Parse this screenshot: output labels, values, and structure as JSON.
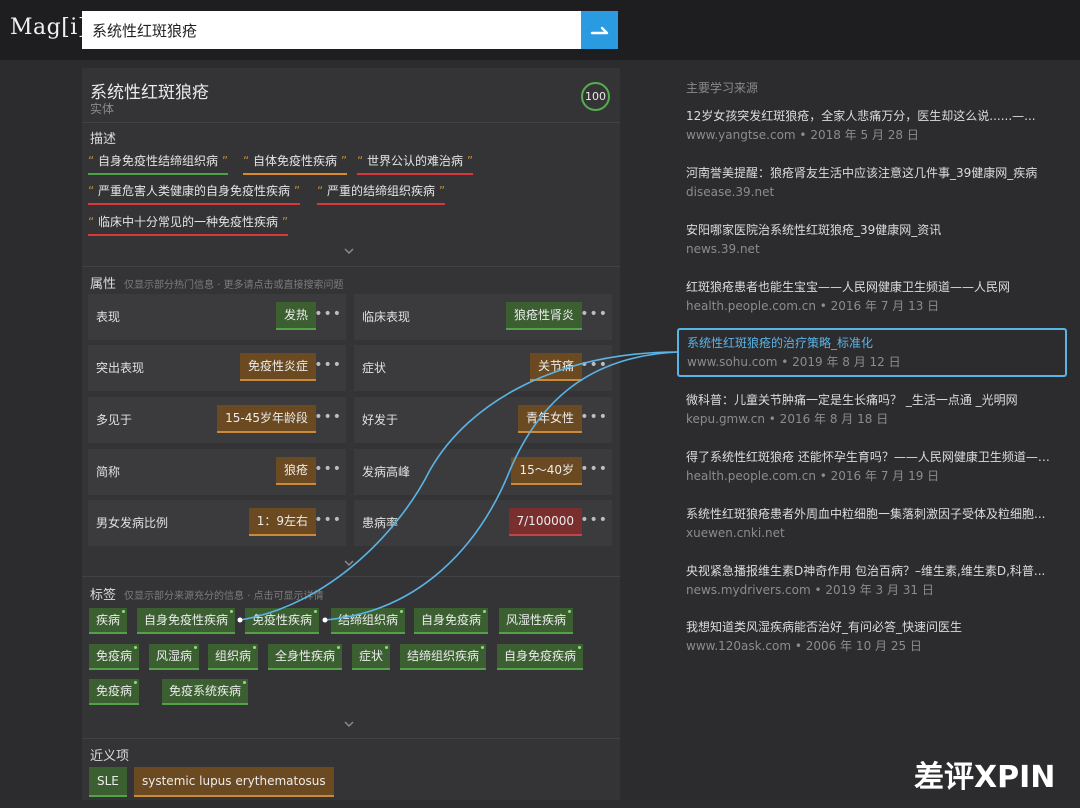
{
  "app": {
    "logo": "Mag[i]"
  },
  "search": {
    "value": "系统性红斑狼疮"
  },
  "entity": {
    "title": "系统性红斑狼疮",
    "type": "实体",
    "score": "100"
  },
  "sections": {
    "description": "描述",
    "attributes": "属性",
    "attributes_note": "仅显示部分热门信息 · 更多请点击或直接搜索问题",
    "tags": "标签",
    "tags_note": "仅显示部分来源充分的信息 · 点击可显示详情",
    "synonyms": "近义项"
  },
  "descriptions": [
    {
      "text": "自身免疫性结缔组织病",
      "color": "green"
    },
    {
      "text": "自体免疫性疾病",
      "color": "orange"
    },
    {
      "text": "世界公认的难治病",
      "color": "red"
    },
    {
      "text": "严重危害人类健康的自身免疫性疾病",
      "color": "red"
    },
    {
      "text": "严重的结缔组织疾病",
      "color": "red"
    },
    {
      "text": "临床中十分常见的一种免疫性疾病",
      "color": "red"
    }
  ],
  "attributes": [
    {
      "name": "表现",
      "value": "发热",
      "color": "green"
    },
    {
      "name": "临床表现",
      "value": "狼疮性肾炎",
      "color": "green"
    },
    {
      "name": "突出表现",
      "value": "免疫性炎症",
      "color": "orange"
    },
    {
      "name": "症状",
      "value": "关节痛",
      "color": "orange"
    },
    {
      "name": "多见于",
      "value": "15-45岁年龄段",
      "color": "orange"
    },
    {
      "name": "好发于",
      "value": "青年女性",
      "color": "orange"
    },
    {
      "name": "简称",
      "value": "狼疮",
      "color": "orange"
    },
    {
      "name": "发病高峰",
      "value": "15～40岁",
      "color": "orange"
    },
    {
      "name": "男女发病比例",
      "value": "1：9左右",
      "color": "orange"
    },
    {
      "name": "患病率",
      "value": "7/100000",
      "color": "red"
    }
  ],
  "more_glyph": "•••",
  "tags": [
    "疾病",
    "自身免疫性疾病",
    "免疫性疾病",
    "结缔组织病",
    "自身免疫病",
    "风湿性疾病",
    "免疫病",
    "风湿病",
    "组织病",
    "全身性疾病",
    "症状",
    "结缔组织疾病",
    "自身免疫疾病",
    "免疫病",
    "免疫系统疾病"
  ],
  "synonyms": [
    {
      "text": "SLE",
      "color": "green"
    },
    {
      "text": "systemic lupus erythematosus",
      "color": "orange"
    }
  ],
  "sources_title": "主要学习来源",
  "sources": [
    {
      "title": "12岁女孩突发红斑狼疮，全家人悲痛万分，医生却这么说......—...",
      "meta": "www.yangtse.com • 2018 年 5 月 28 日",
      "active": false
    },
    {
      "title": "河南誉美提醒：狼疮肾友生活中应该注意这几件事_39健康网_疾病",
      "meta": "disease.39.net",
      "active": false
    },
    {
      "title": "安阳哪家医院治系统性红斑狼疮_39健康网_资讯",
      "meta": "news.39.net",
      "active": false
    },
    {
      "title": "红斑狼疮患者也能生宝宝——人民网健康卫生频道——人民网",
      "meta": "health.people.com.cn • 2016 年 7 月 13 日",
      "active": false
    },
    {
      "title": "系统性红斑狼疮的治疗策略_标准化",
      "meta": "www.sohu.com • 2019 年 8 月 12 日",
      "active": true
    },
    {
      "title": "微科普：儿童关节肿痛一定是生长痛吗？ _生活一点通 _光明网",
      "meta": "kepu.gmw.cn • 2016 年 8 月 18 日",
      "active": false
    },
    {
      "title": "得了系统性红斑狼疮 还能怀孕生育吗？——人民网健康卫生频道——...",
      "meta": "health.people.com.cn • 2016 年 7 月 19 日",
      "active": false
    },
    {
      "title": "系统性红斑狼疮患者外周血中粒细胞一集落刺激因子受体及粒细胞...",
      "meta": "xuewen.cnki.net",
      "active": false
    },
    {
      "title": "央视紧急播报维生素D神奇作用 包治百病？–维生素,维生素D,科普...",
      "meta": "news.mydrivers.com • 2019 年 3 月 31 日",
      "active": false
    },
    {
      "title": "我想知道类风湿疾病能否治好_有问必答_快速问医生",
      "meta": "www.120ask.com • 2006 年 10 月 25 日",
      "active": false
    }
  ],
  "watermark": "差评XPIN"
}
